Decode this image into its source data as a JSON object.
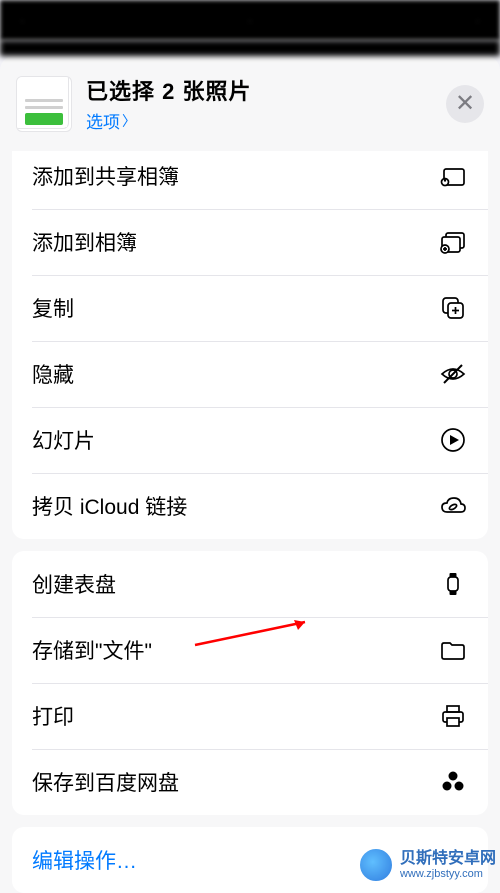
{
  "header": {
    "selection_title": "已选择 2 张照片",
    "options_label": "选项"
  },
  "group1": {
    "rows": [
      {
        "label": "添加到共享相簿",
        "icon": "shared-album-icon"
      },
      {
        "label": "添加到相簿",
        "icon": "album-add-icon"
      },
      {
        "label": "复制",
        "icon": "copy-icon"
      },
      {
        "label": "隐藏",
        "icon": "hide-icon"
      },
      {
        "label": "幻灯片",
        "icon": "play-icon"
      },
      {
        "label": "拷贝 iCloud 链接",
        "icon": "icloud-link-icon"
      }
    ]
  },
  "group2": {
    "rows": [
      {
        "label": "创建表盘",
        "icon": "watch-icon"
      },
      {
        "label": "存储到\"文件\"",
        "icon": "files-icon"
      },
      {
        "label": "打印",
        "icon": "print-icon"
      },
      {
        "label": "保存到百度网盘",
        "icon": "baidu-icon"
      }
    ]
  },
  "edit_actions_label": "编辑操作…",
  "watermark": {
    "title": "贝斯特安卓网",
    "url": "www.zjbstyy.com"
  }
}
